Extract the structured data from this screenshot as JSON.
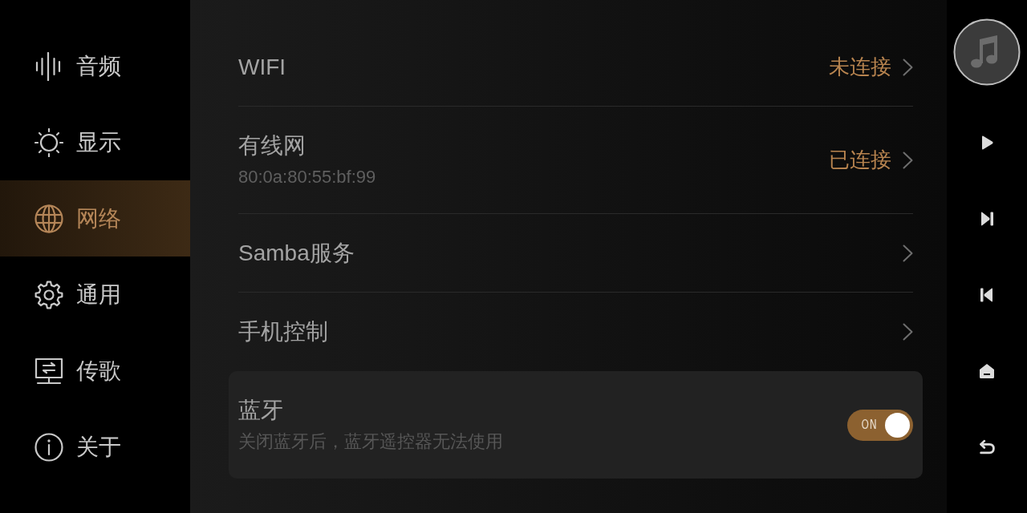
{
  "sidebar": {
    "items": [
      {
        "label": "音频",
        "selected": false
      },
      {
        "label": "显示",
        "selected": false
      },
      {
        "label": "网络",
        "selected": true
      },
      {
        "label": "通用",
        "selected": false
      },
      {
        "label": "传歌",
        "selected": false
      },
      {
        "label": "关于",
        "selected": false
      }
    ]
  },
  "settings": {
    "rows": [
      {
        "kind": "link",
        "title": "WIFI",
        "status": "未连接",
        "selected": false
      },
      {
        "kind": "link",
        "title": "有线网",
        "subtitle": "80:0a:80:55:bf:99",
        "status": "已连接",
        "selected": false
      },
      {
        "kind": "link",
        "title": "Samba服务",
        "selected": false
      },
      {
        "kind": "link",
        "title": "手机控制",
        "selected": false
      },
      {
        "kind": "toggle",
        "title": "蓝牙",
        "subtitle": "关闭蓝牙后，蓝牙遥控器无法使用",
        "toggle_label": "ON",
        "on": true,
        "selected": true
      }
    ]
  }
}
